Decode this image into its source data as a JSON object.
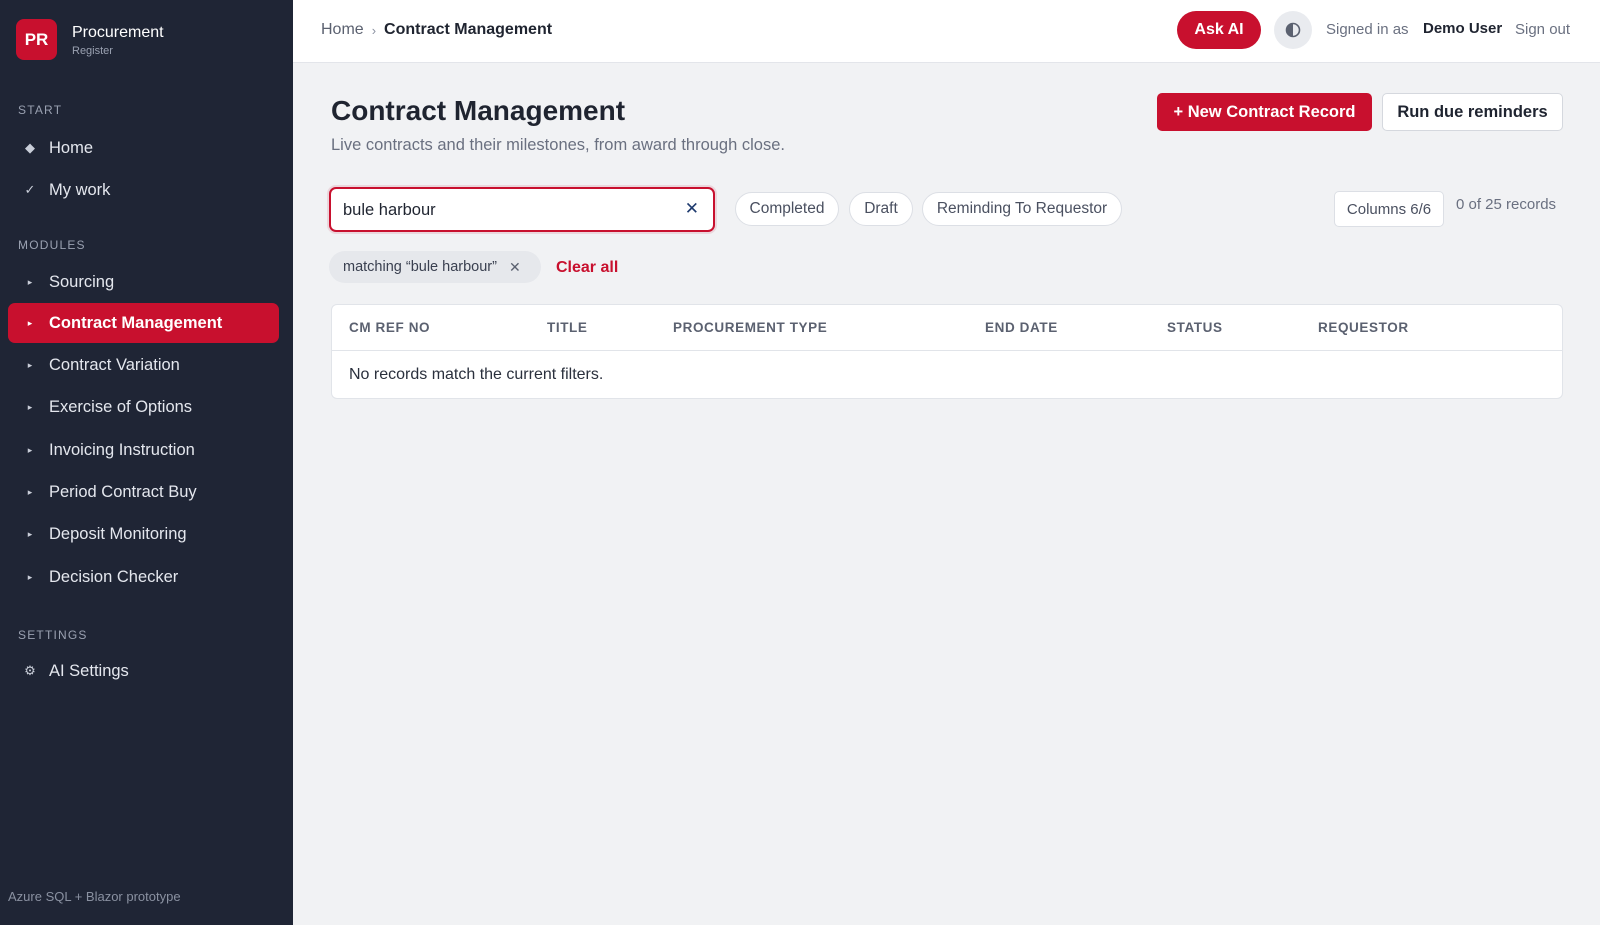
{
  "brand": {
    "logo": "PR",
    "name": "Procurement",
    "subtitle": "Register"
  },
  "sidebar": {
    "sections": {
      "start": "START",
      "modules": "MODULES",
      "settings": "SETTINGS"
    },
    "items": [
      {
        "label": "Home",
        "icon": "diamond-icon",
        "glyph": "◆"
      },
      {
        "label": "My work",
        "icon": "check-icon",
        "glyph": "✓"
      },
      {
        "label": "Sourcing",
        "icon": "caret-right-icon",
        "glyph": "▸"
      },
      {
        "label": "Contract Management",
        "icon": "caret-right-icon",
        "glyph": "▸",
        "active": true
      },
      {
        "label": "Contract Variation",
        "icon": "caret-right-icon",
        "glyph": "▸"
      },
      {
        "label": "Exercise of Options",
        "icon": "caret-right-icon",
        "glyph": "▸"
      },
      {
        "label": "Invoicing Instruction",
        "icon": "caret-right-icon",
        "glyph": "▸"
      },
      {
        "label": "Period Contract Buy",
        "icon": "caret-right-icon",
        "glyph": "▸"
      },
      {
        "label": "Deposit Monitoring",
        "icon": "caret-right-icon",
        "glyph": "▸"
      },
      {
        "label": "Decision Checker",
        "icon": "caret-right-icon",
        "glyph": "▸"
      },
      {
        "label": "AI Settings",
        "icon": "gear-icon",
        "glyph": "⚙"
      }
    ],
    "footer": "Azure SQL + Blazor prototype"
  },
  "topbar": {
    "breadcrumb": {
      "home": "Home",
      "separator": "›",
      "current": "Contract Management"
    },
    "ask_ai": "Ask AI",
    "signed_in_label": "Signed in as",
    "user": "Demo User",
    "sign_out": "Sign out"
  },
  "main": {
    "title": "Contract Management",
    "subtitle": "Live contracts and their milestones, from award through close.",
    "new_button": "+ New Contract Record",
    "run_button": "Run due reminders",
    "search": {
      "value": "bule harbour",
      "clear_glyph": "✕"
    },
    "status_chips": [
      "Completed",
      "Draft",
      "Reminding To Requestor"
    ],
    "columns_button": "Columns 6/6",
    "record_count": "0 of 25 records",
    "active_filter": {
      "label": "matching “bule harbour”",
      "remove_glyph": "✕"
    },
    "clear_all": "Clear all",
    "table": {
      "columns": [
        "CM REF NO",
        "TITLE",
        "PROCUREMENT TYPE",
        "END DATE",
        "STATUS",
        "REQUESTOR"
      ],
      "empty_message": "No records match the current filters."
    }
  },
  "colors": {
    "accent": "#c8102e",
    "sidebar_bg": "#1f2535",
    "page_bg": "#f1f2f4"
  }
}
